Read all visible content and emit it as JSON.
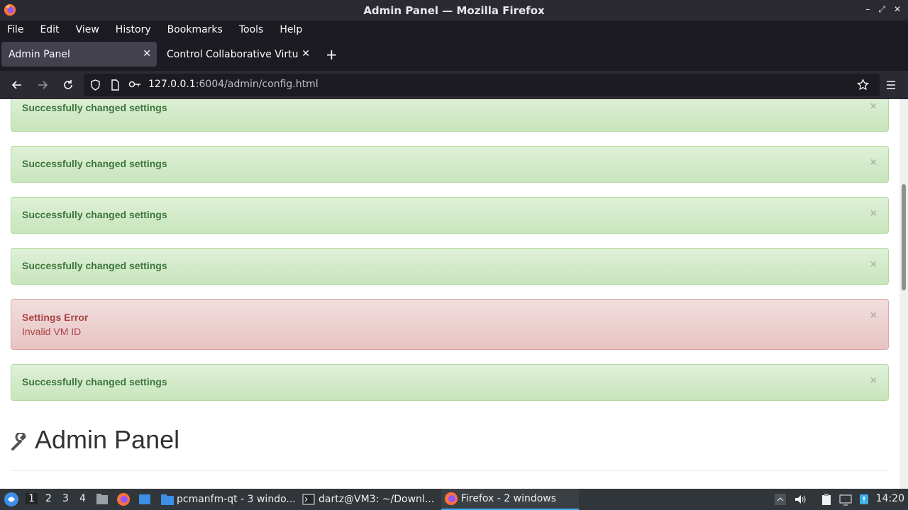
{
  "window": {
    "title": "Admin Panel — Mozilla Firefox",
    "controls": [
      "–",
      "⤢",
      "✕"
    ]
  },
  "menu": {
    "items": [
      "File",
      "Edit",
      "View",
      "History",
      "Bookmarks",
      "Tools",
      "Help"
    ]
  },
  "tabs": [
    {
      "label": "Admin Panel",
      "active": true
    },
    {
      "label": "Control Collaborative Virtual",
      "active": false
    }
  ],
  "navbar": {
    "url_host": "127.0.0.1",
    "url_rest": ":6004/admin/config.html"
  },
  "alerts": [
    {
      "type": "success",
      "title": "Successfully changed settings",
      "message": ""
    },
    {
      "type": "success",
      "title": "Successfully changed settings",
      "message": ""
    },
    {
      "type": "success",
      "title": "Successfully changed settings",
      "message": ""
    },
    {
      "type": "success",
      "title": "Successfully changed settings",
      "message": ""
    },
    {
      "type": "danger",
      "title": "Settings Error",
      "message": "Invalid VM ID"
    },
    {
      "type": "success",
      "title": "Successfully changed settings",
      "message": ""
    }
  ],
  "alert_close": "×",
  "page": {
    "heading": "Admin Panel"
  },
  "taskbar": {
    "workspaces": [
      "1",
      "2",
      "3",
      "4"
    ],
    "tasks": [
      {
        "label": "pcmanfm-qt - 3 windo...",
        "icon": "folder-icon",
        "active": false
      },
      {
        "label": "dartz@VM3: ~/Downl...",
        "icon": "terminal-icon",
        "active": false
      },
      {
        "label": "Firefox - 2 windows",
        "icon": "firefox-icon",
        "active": true
      }
    ],
    "clock": "14:20"
  },
  "colors": {
    "success_text": "#3c763d",
    "danger_text": "#a94442",
    "accent": "#3daee9"
  }
}
